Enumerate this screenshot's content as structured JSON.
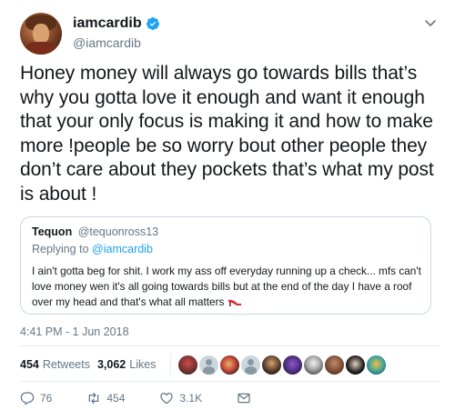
{
  "author": {
    "display_name": "iamcardib",
    "handle": "@iamcardib",
    "verified": true
  },
  "tweet": {
    "text": "Honey money will always go towards bills that’s why you gotta love it enough and want it enough that your only focus is making it and how to make more !people be so worry bout other people they don’t care about they pockets that’s what my post is about !"
  },
  "quoted": {
    "display_name": "Tequon",
    "handle": "@tequonross13",
    "replying_prefix": "Replying to",
    "replying_to": "@iamcardib",
    "text": "I ain't gotta beg for shit. I work my ass off everyday running up a check... mfs can't love money wen it's all going towards bills but at the end of the day I have a roof over my head and that's what all matters"
  },
  "timestamp": "4:41 PM - 1 Jun 2018",
  "stats": {
    "retweets_count": "454",
    "retweets_label": "Retweets",
    "likes_count": "3,062",
    "likes_label": "Likes"
  },
  "actions": {
    "replies": "76",
    "retweets": "454",
    "likes": "3.1K"
  },
  "icons": {
    "verified": "verified-badge-icon",
    "more": "chevron-down-icon",
    "reply": "reply-icon",
    "retweet": "retweet-icon",
    "like": "heart-icon",
    "dm": "direct-message-icon"
  },
  "colors": {
    "text": "#14171a",
    "secondary": "#657786",
    "link": "#1da1f2",
    "border": "#ccd6dd",
    "divider": "#e6ecf0"
  }
}
